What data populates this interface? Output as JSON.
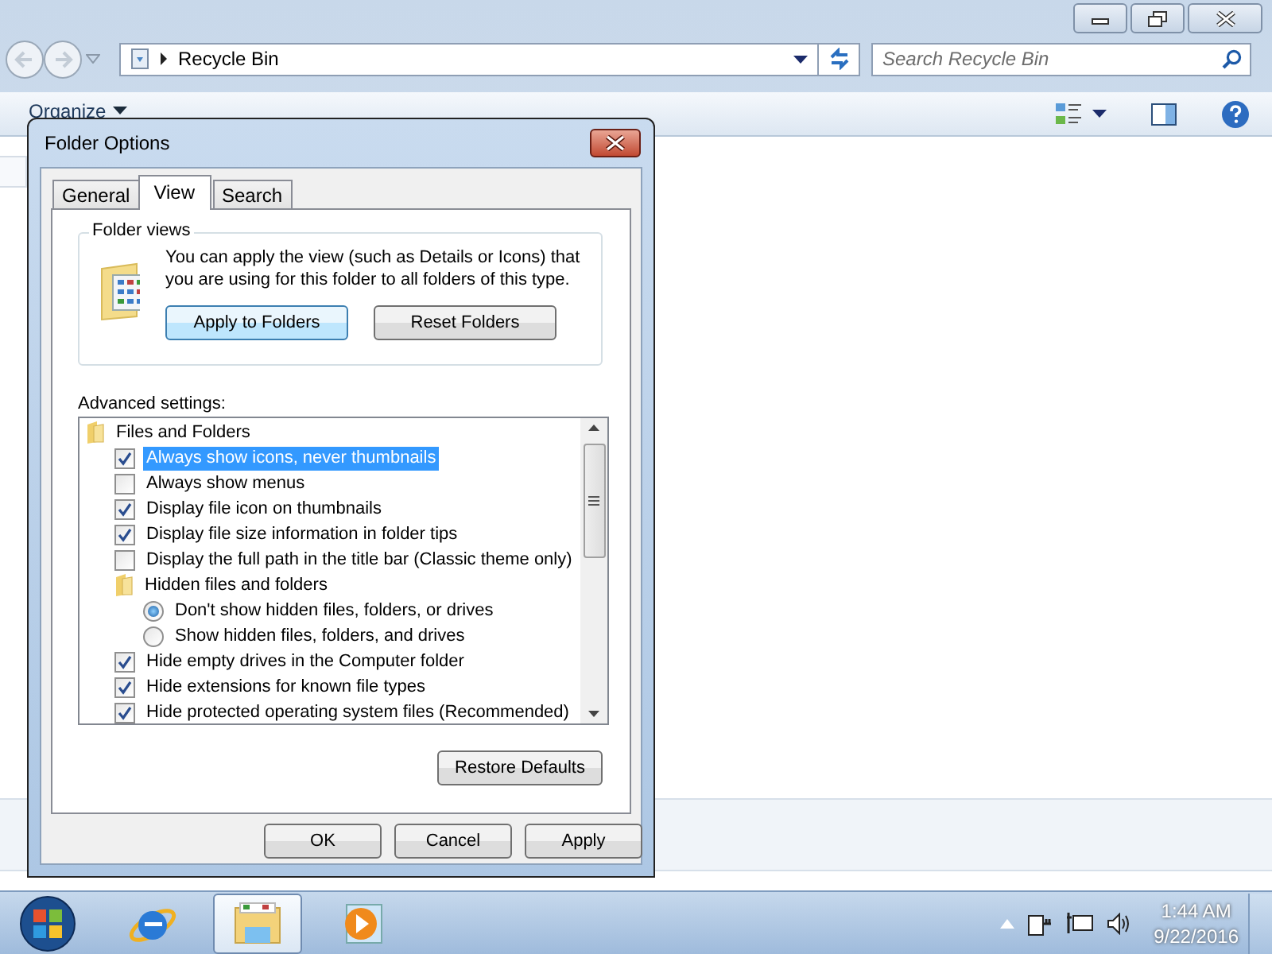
{
  "explorer": {
    "address": {
      "location": "Recycle Bin"
    },
    "search": {
      "placeholder": "Search Recycle Bin"
    },
    "toolbar": {
      "organize": "Organize"
    }
  },
  "dialog": {
    "title": "Folder Options",
    "tabs": [
      {
        "label": "General",
        "selected": false
      },
      {
        "label": "View",
        "selected": true
      },
      {
        "label": "Search",
        "selected": false
      }
    ],
    "folder_views": {
      "legend": "Folder views",
      "description": "You can apply the view (such as Details or Icons) that you are using for this folder to all folders of this type.",
      "buttons": [
        {
          "label": "Apply to Folders",
          "focused": true
        },
        {
          "label": "Reset Folders",
          "focused": false
        }
      ]
    },
    "advanced_label": "Advanced settings:",
    "settings": [
      {
        "kind": "folder",
        "label": "Files and Folders",
        "selected": false,
        "children": [
          {
            "kind": "checkbox",
            "label": "Always show icons, never thumbnails",
            "checked": true,
            "selected": true
          },
          {
            "kind": "checkbox",
            "label": "Always show menus",
            "checked": false,
            "selected": false
          },
          {
            "kind": "checkbox",
            "label": "Display file icon on thumbnails",
            "checked": true,
            "selected": false
          },
          {
            "kind": "checkbox",
            "label": "Display file size information in folder tips",
            "checked": true,
            "selected": false
          },
          {
            "kind": "checkbox",
            "label": "Display the full path in the title bar (Classic theme only)",
            "checked": false,
            "selected": false
          },
          {
            "kind": "folder",
            "label": "Hidden files and folders",
            "selected": false,
            "children": [
              {
                "kind": "radio",
                "label": "Don't show hidden files, folders, or drives",
                "checked": true,
                "selected": false
              },
              {
                "kind": "radio",
                "label": "Show hidden files, folders, and drives",
                "checked": false,
                "selected": false
              }
            ]
          },
          {
            "kind": "checkbox",
            "label": "Hide empty drives in the Computer folder",
            "checked": true,
            "selected": false
          },
          {
            "kind": "checkbox",
            "label": "Hide extensions for known file types",
            "checked": true,
            "selected": false
          },
          {
            "kind": "checkbox",
            "label": "Hide protected operating system files (Recommended)",
            "checked": true,
            "selected": false
          }
        ]
      }
    ],
    "restore_button": "Restore Defaults",
    "buttons": [
      "OK",
      "Cancel",
      "Apply"
    ]
  },
  "taskbar": {
    "apps": [
      {
        "kind": "browser",
        "selected": false
      },
      {
        "kind": "files",
        "selected": true
      },
      {
        "kind": "media",
        "selected": false
      }
    ],
    "clock": {
      "time": "1:44 AM",
      "date": "9/22/2016"
    }
  }
}
